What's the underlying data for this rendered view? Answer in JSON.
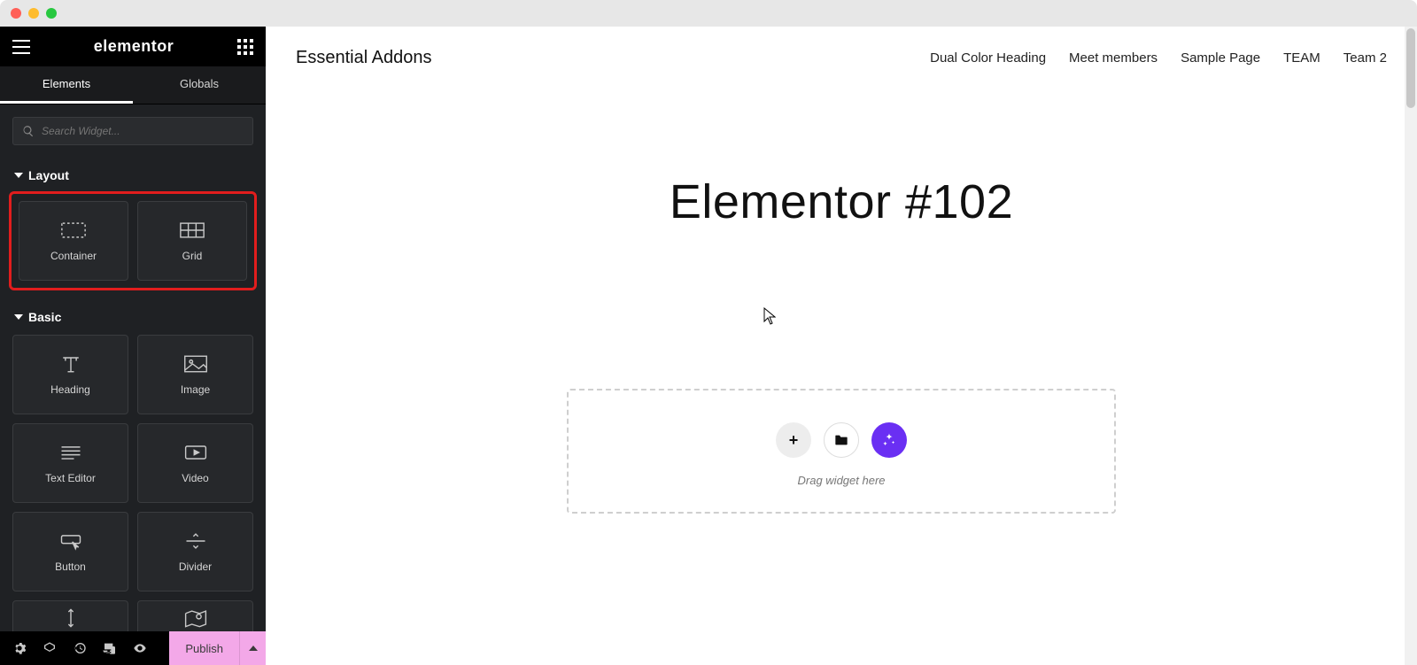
{
  "window": {
    "platform": "mac"
  },
  "sidebar": {
    "logo": "elementor",
    "tabs": {
      "elements": "Elements",
      "globals": "Globals"
    },
    "search": {
      "placeholder": "Search Widget..."
    },
    "sections": {
      "layout": {
        "title": "Layout",
        "widgets": [
          {
            "label": "Container",
            "icon": "container-icon"
          },
          {
            "label": "Grid",
            "icon": "grid-icon"
          }
        ]
      },
      "basic": {
        "title": "Basic",
        "widgets": [
          {
            "label": "Heading",
            "icon": "heading-icon"
          },
          {
            "label": "Image",
            "icon": "image-icon"
          },
          {
            "label": "Text Editor",
            "icon": "text-editor-icon"
          },
          {
            "label": "Video",
            "icon": "video-icon"
          },
          {
            "label": "Button",
            "icon": "button-icon"
          },
          {
            "label": "Divider",
            "icon": "divider-icon"
          }
        ]
      }
    }
  },
  "footer": {
    "publish": "Publish"
  },
  "page": {
    "site_title": "Essential Addons",
    "nav": [
      "Dual Color Heading",
      "Meet members",
      "Sample Page",
      "TEAM",
      "Team 2"
    ],
    "page_title": "Elementor #102",
    "dropzone_hint": "Drag widget here"
  },
  "colors": {
    "highlight_border": "#e11d1d",
    "ai_button": "#6a2ff3",
    "publish_bg": "#f3a8e8"
  }
}
